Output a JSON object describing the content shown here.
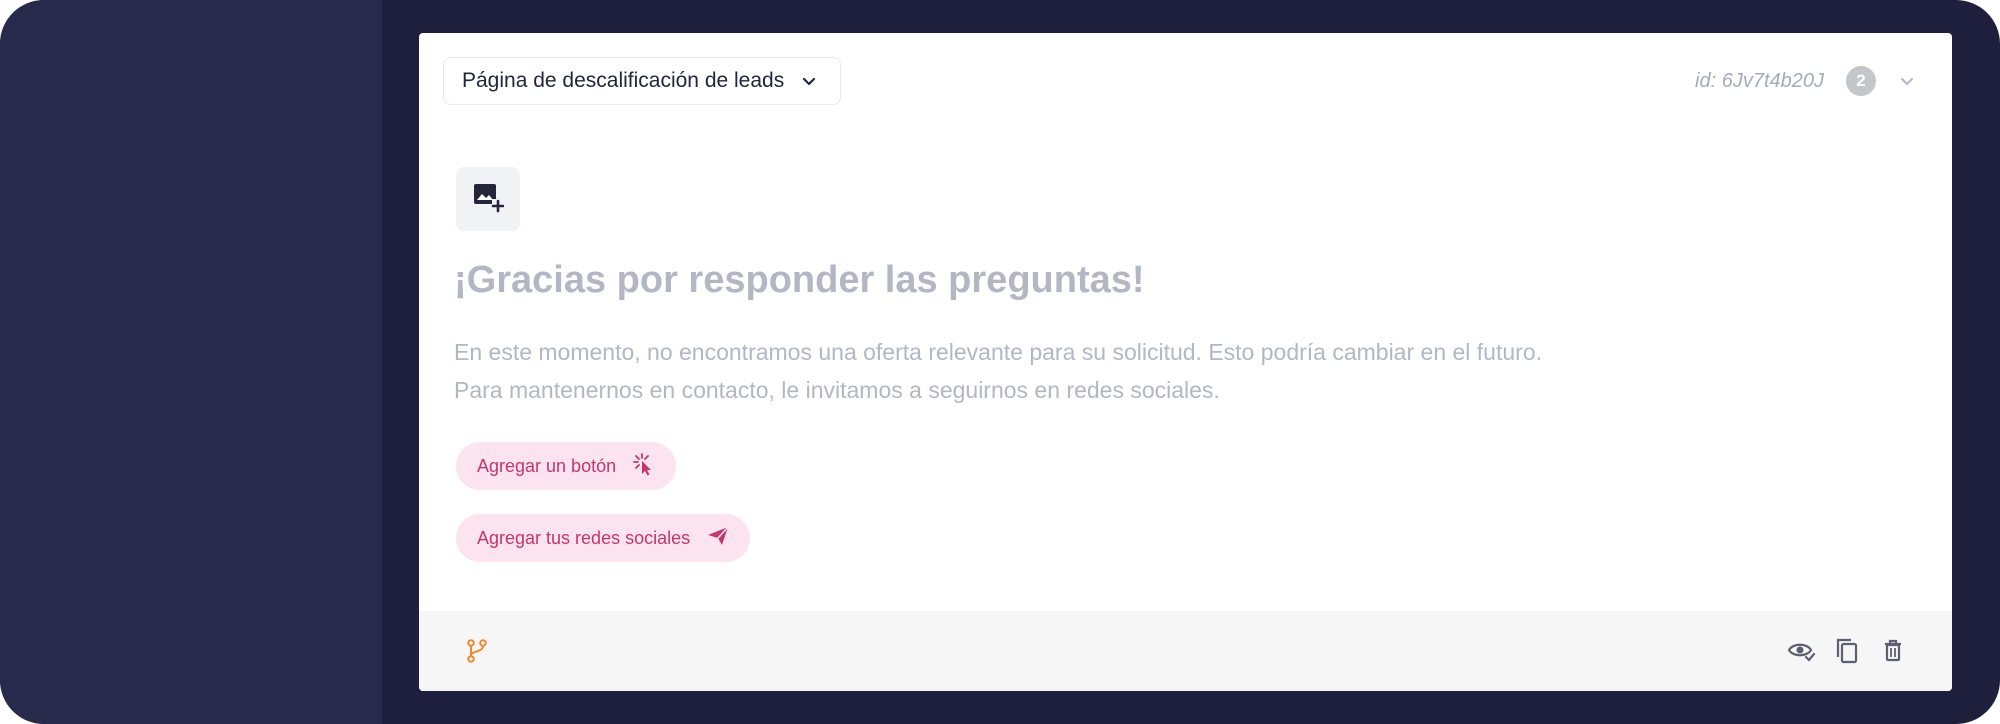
{
  "block": {
    "page_type": "Página de descalificación de leads",
    "id_text": "id: 6Jv7t4b20J",
    "badge_count": "2"
  },
  "content": {
    "title": "¡Gracias por responder las preguntas!",
    "description": "En este momento, no encontramos una oferta relevante para su solicitud. Esto podría cambiar en el futuro. Para mantenernos en contacto, le invitamos a seguirnos en redes sociales."
  },
  "actions": {
    "add_button_label": "Agregar un botón",
    "add_social_label": "Agregar tus redes sociales"
  },
  "icons": {
    "image_add": "image-add-icon",
    "cursor_click": "cursor-click-icon",
    "send": "send-icon",
    "branch": "branch-icon",
    "preview": "eye-icon",
    "duplicate": "copy-icon",
    "delete": "trash-icon"
  },
  "colors": {
    "frame_bg": "#1e1f3d",
    "sidebar_bg": "#272a4a",
    "accent_pink": "#c3366e",
    "pill_bg": "#fbe4ef",
    "branch_orange": "#f0882e"
  }
}
